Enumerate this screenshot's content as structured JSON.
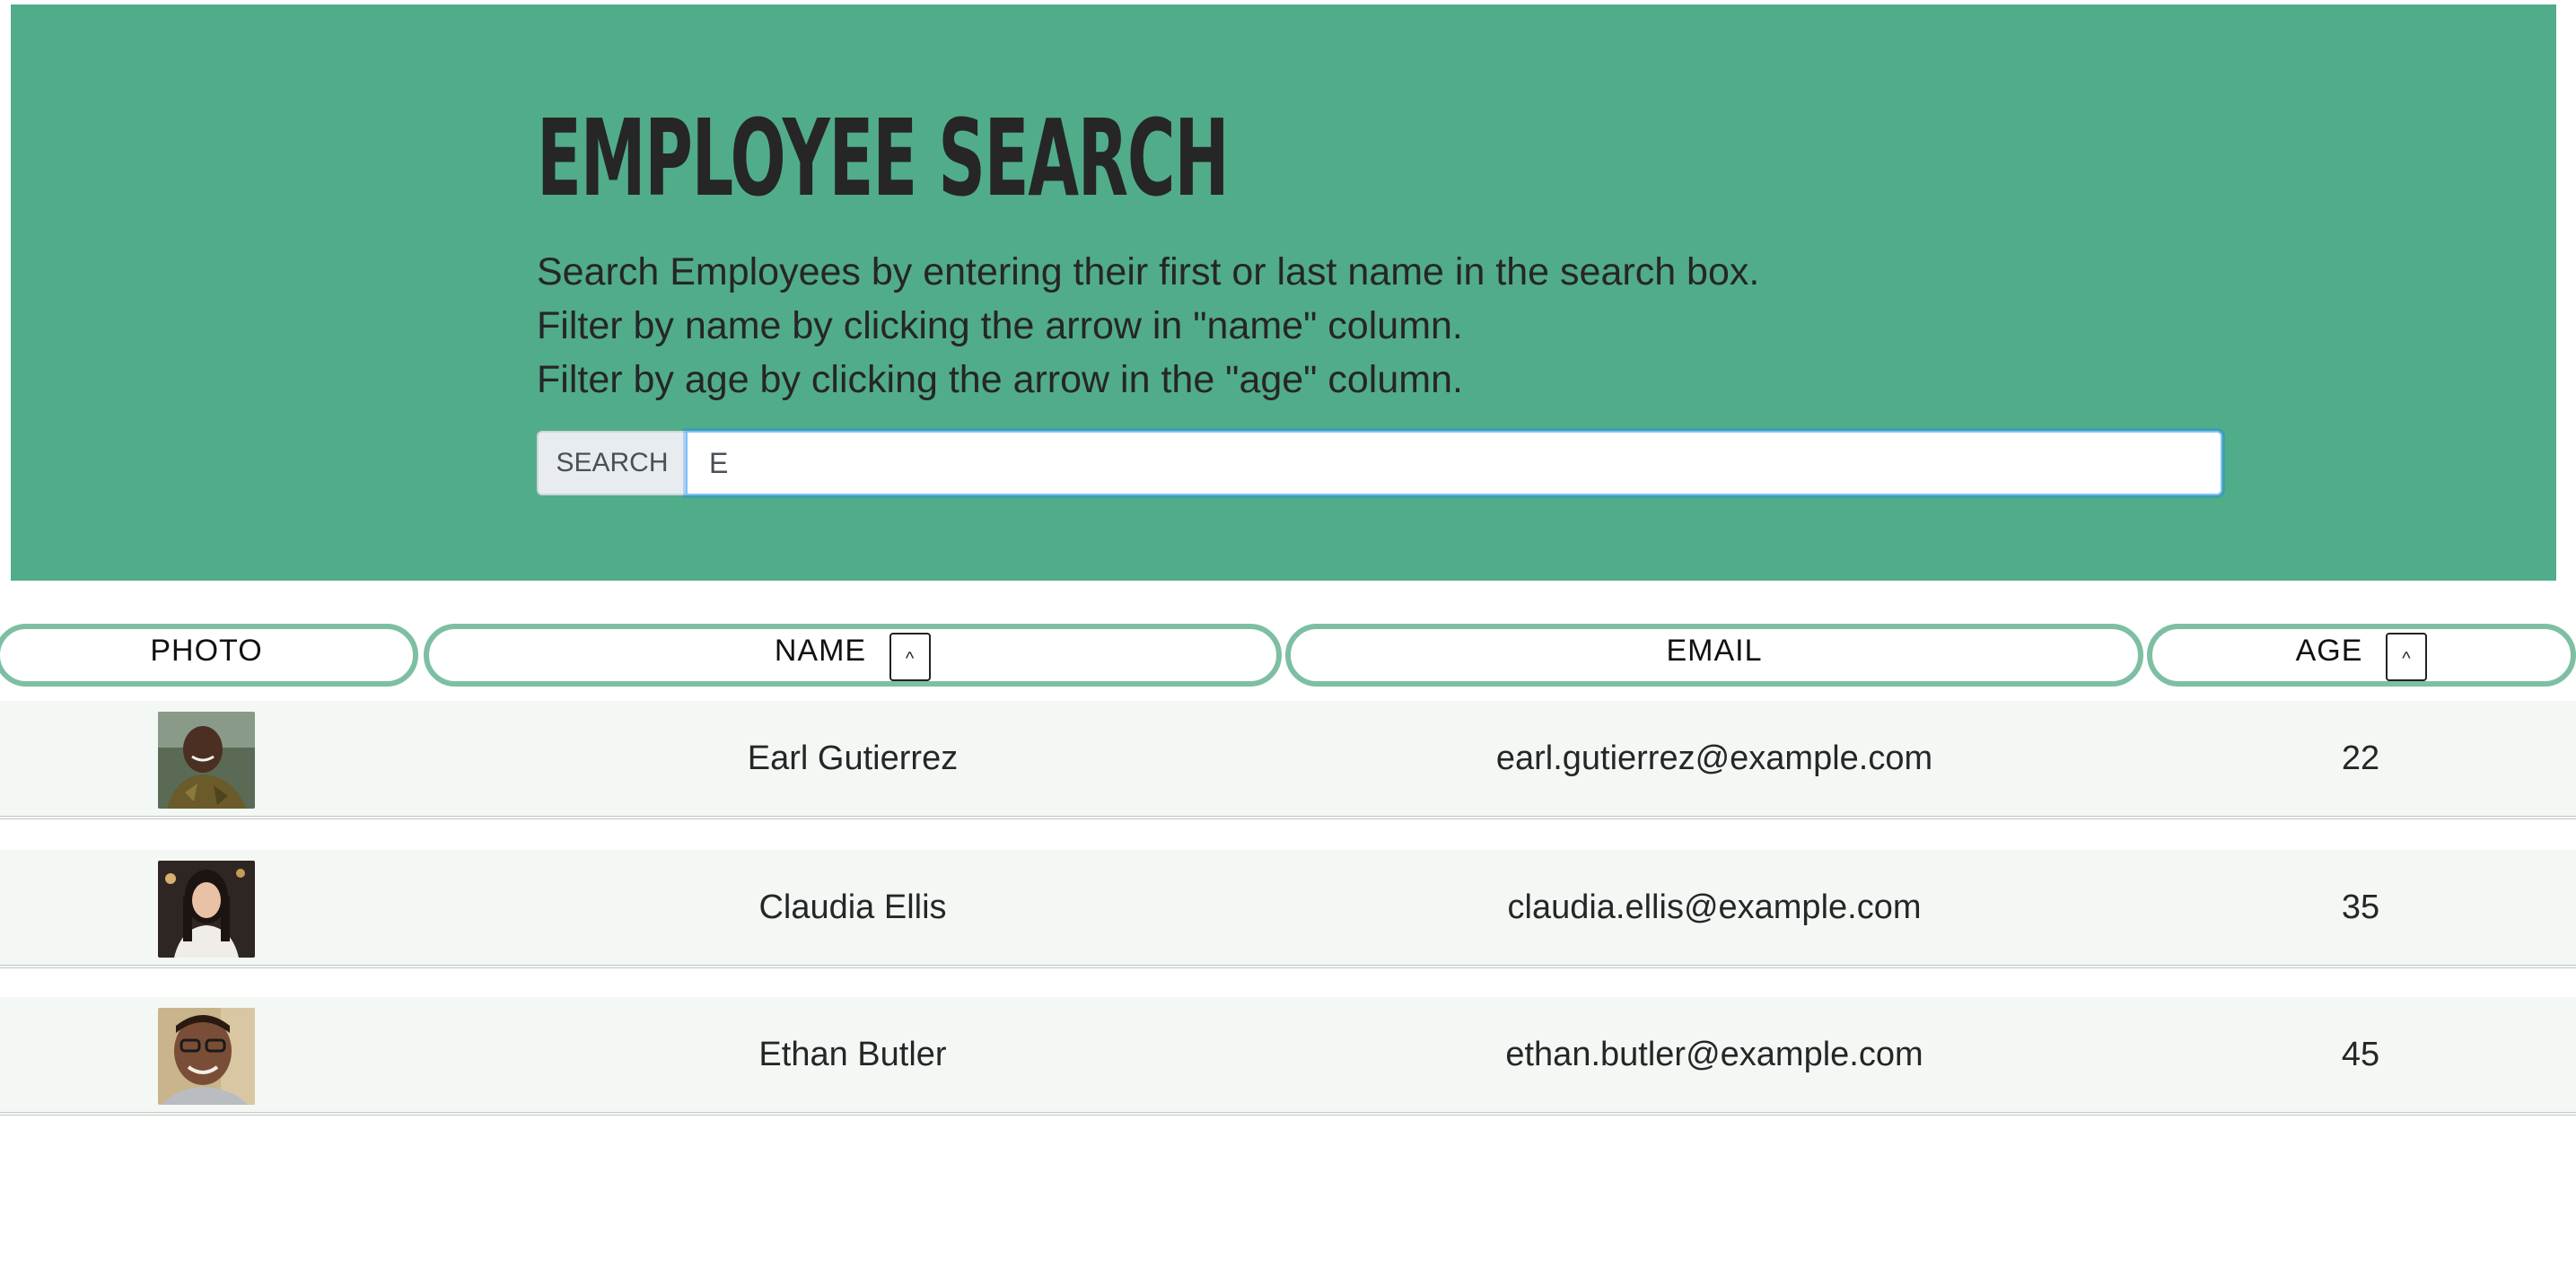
{
  "header": {
    "title": "EMPLOYEE SEARCH",
    "description": [
      "Search Employees by entering their first or last name in the search box.",
      "Filter by name by clicking the arrow in \"name\" column.",
      "Filter by age by clicking the arrow in the \"age\" column."
    ],
    "search_label": "SEARCH",
    "search_value": "E"
  },
  "table": {
    "columns": {
      "photo": "PHOTO",
      "name": "NAME",
      "email": "EMAIL",
      "age": "AGE"
    },
    "sort_glyph": "^",
    "rows": [
      {
        "name": "Earl Gutierrez",
        "email": "earl.gutierrez@example.com",
        "age": "22"
      },
      {
        "name": "Claudia Ellis",
        "email": "claudia.ellis@example.com",
        "age": "35"
      },
      {
        "name": "Ethan Butler",
        "email": "ethan.butler@example.com",
        "age": "45"
      }
    ]
  },
  "colors": {
    "hero_bg": "#51ac8a",
    "header_border": "#7ebfa3",
    "row_bg": "#f3f8f5",
    "input_focus": "#80bdff"
  }
}
